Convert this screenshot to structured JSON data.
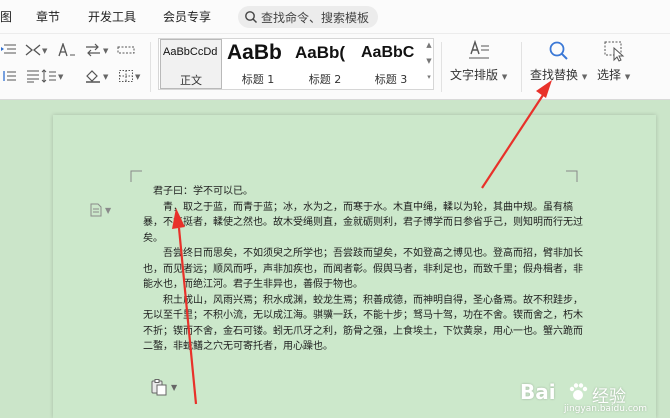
{
  "menubar": {
    "items": [
      "图",
      "章节",
      "开发工具",
      "会员专享"
    ],
    "search_placeholder": "查找命令、搜索模板"
  },
  "ribbon": {
    "styles": [
      {
        "preview": "AaBbCcDd",
        "label": "正文"
      },
      {
        "preview": "AaBb",
        "label": "标题 1"
      },
      {
        "preview": "AaBb(",
        "label": "标题 2"
      },
      {
        "preview": "AaBbC",
        "label": "标题 3"
      }
    ],
    "text_layout_label": "文字排版",
    "find_replace_label": "查找替换",
    "select_label": "选择"
  },
  "document": {
    "paragraphs": [
      "君子曰：学不可以已。",
      "青，取之于蓝，而青于蓝；冰，水为之，而寒于水。木直中绳，輮以为轮，其曲中规。虽有槁暴，不复挺者，輮使之然也。故木受绳则直，金就砺则利，君子博学而日参省乎己，则知明而行无过矣。",
      "吾尝终日而思矣，不如须臾之所学也；吾尝跂而望矣，不如登高之博见也。登高而招，臂非加长也，而见者远；顺风而呼，声非加疾也，而闻者彰。假舆马者，非利足也，而致千里；假舟楫者，非能水也，而绝江河。君子生非异也，善假于物也。",
      "积土成山，风雨兴焉；积水成渊，蛟龙生焉；积善成德，而神明自得，圣心备焉。故不积跬步，无以至千里；不积小流，无以成江海。骐骥一跃，不能十步；驽马十驾，功在不舍。锲而舍之，朽木不折；锲而不舍，金石可镂。蚓无爪牙之利，筋骨之强，上食埃土，下饮黄泉，用心一也。蟹六跪而二螯，非蛇鳝之穴无可寄托者，用心躁也。"
    ]
  },
  "watermark": {
    "brand": "Bai",
    "brand_cn": "经验",
    "url": "jingyan.baidu.com"
  },
  "colors": {
    "page_bg": "#cce8cb",
    "app_bg": "#cbe5c9",
    "arrow": "#e8312a",
    "find_icon": "#3a78d6"
  }
}
